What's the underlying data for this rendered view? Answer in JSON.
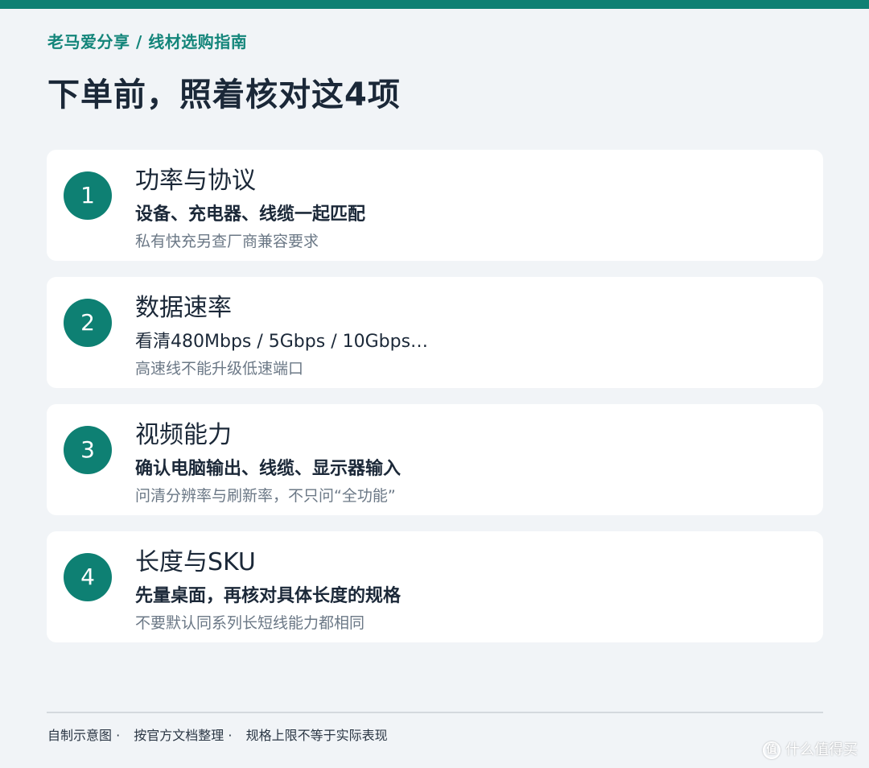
{
  "header": {
    "breadcrumb": "老马爱分享 / 线材选购指南",
    "title": "下单前，照着核对这4项"
  },
  "colors": {
    "accent": "#0e8073",
    "background": "#f1f4f7",
    "card": "#ffffff"
  },
  "items": [
    {
      "number": "1",
      "title": "功率与协议",
      "main": "设备、充电器、线缆一起匹配",
      "note": "私有快充另查厂商兼容要求"
    },
    {
      "number": "2",
      "title": "数据速率",
      "main": "看清480Mbps / 5Gbps / 10Gbps…",
      "note": "高速线不能升级低速端口"
    },
    {
      "number": "3",
      "title": "视频能力",
      "main": "确认电脑输出、线缆、显示器输入",
      "note": "问清分辨率与刷新率，不只问“全功能”"
    },
    {
      "number": "4",
      "title": "长度与SKU",
      "main": "先量桌面，再核对具体长度的规格",
      "note": "不要默认同系列长短线能力都相同"
    }
  ],
  "footer": {
    "part1": "自制示意图 ·",
    "part2": "按官方文档整理 ·",
    "part3": "规格上限不等于实际表现"
  },
  "watermark": {
    "icon": "值",
    "text": "什么值得买"
  }
}
